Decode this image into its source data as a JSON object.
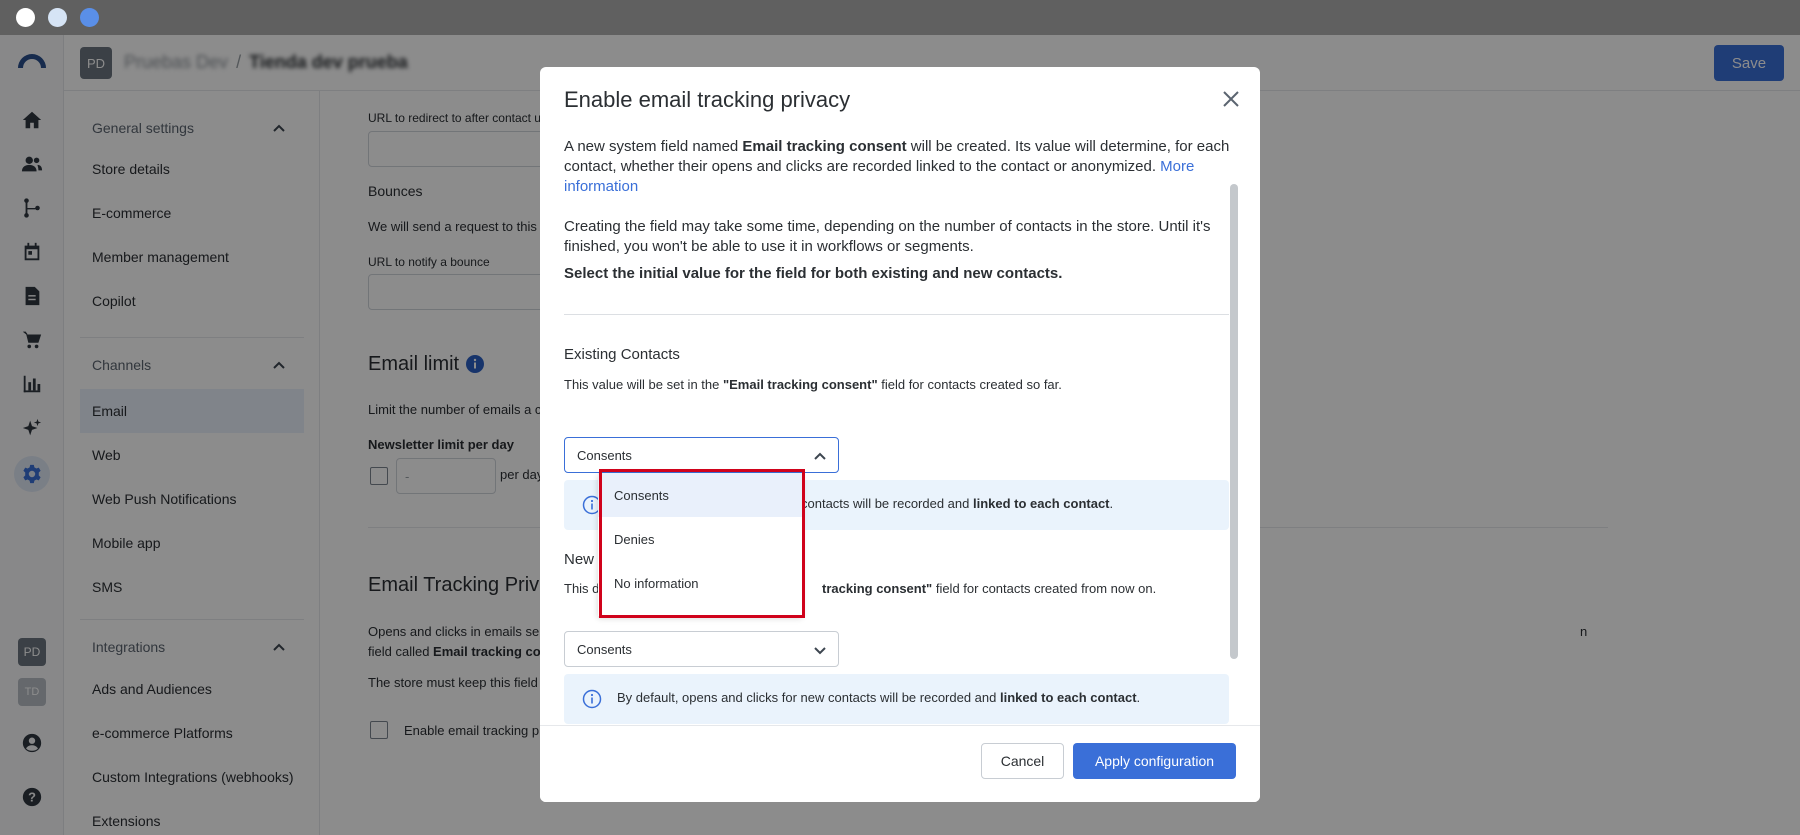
{
  "colors": {
    "accent": "#3a6fd8",
    "highlight_border": "#d0021b",
    "info_bg": "#eaf3fc"
  },
  "header": {
    "avatar_initials": "PD",
    "org_name": "Pruebas Dev",
    "store_name": "Tienda dev prueba",
    "save_label": "Save"
  },
  "rail": {
    "icons": [
      "logo-icon",
      "home-icon",
      "contacts-icon",
      "workflows-icon",
      "calendar-icon",
      "templates-icon",
      "cart-icon",
      "reports-icon",
      "copilot-icon",
      "settings-icon",
      "user-icon",
      "help-icon"
    ],
    "badges": [
      "PD",
      "TD"
    ]
  },
  "sidebar": {
    "general_settings": "General settings",
    "general_items": [
      "Store details",
      "E-commerce",
      "Member management",
      "Copilot"
    ],
    "channels": "Channels",
    "channel_items": [
      "Email",
      "Web",
      "Web Push Notifications",
      "Mobile app",
      "SMS"
    ],
    "integrations": "Integrations",
    "integration_items": [
      "Ads and Audiences",
      "e-commerce Platforms",
      "Custom Integrations (webhooks)",
      "Extensions"
    ]
  },
  "background": {
    "redirect_label": "URL to redirect to after contact uns",
    "bounces_heading": "Bounces",
    "bounces_desc": "We will send a request to this",
    "bounce_url_label": "URL to notify a bounce",
    "email_limit_heading": "Email limit",
    "email_limit_desc": "Limit the number of emails a c",
    "newsletter_limit_label": "Newsletter limit per day",
    "newsletter_placeholder": "-",
    "per_day": "per day",
    "tracking_heading": "Email Tracking Priva",
    "tracking_desc_1": "Opens and clicks in emails ser",
    "tracking_desc_1_end": "n",
    "tracking_desc_2_pre": "field called ",
    "tracking_desc_2_bold": "Email tracking co",
    "tracking_desc_3": "The store must keep this field",
    "enable_checkbox_label": "Enable email tracking p"
  },
  "modal": {
    "title": "Enable email tracking privacy",
    "p1_pre": "A new system field named ",
    "p1_bold": "Email tracking consent",
    "p1_post": " will be created. Its value will determine, for each contact, whether their opens and clicks are recorded linked to the contact or anonymized. ",
    "p1_link": "More information",
    "p2": "Creating the field may take some time, depending on the number of contacts in the store. Until it's finished, you won't be able to use it in workflows or segments.",
    "p3": "Select the initial value for the field for both existing and new contacts.",
    "existing": {
      "heading": "Existing Contacts",
      "desc_pre": "This value will be set in the ",
      "desc_bold": "\"Email tracking consent\"",
      "desc_post": " field for contacts created so far.",
      "value": "Consents",
      "info_pre": "contacts will be recorded and ",
      "info_bold": "linked to each contact",
      "info_post": "."
    },
    "new": {
      "heading": "New",
      "desc_pre": "This d",
      "desc_bold": " tracking consent\"",
      "desc_post": " field for contacts created from now on.",
      "value": "Consents",
      "info_pre": "By default, opens and clicks for new contacts will be recorded and ",
      "info_bold": "linked to each contact",
      "info_post": "."
    },
    "dropdown_options": [
      "Consents",
      "Denies",
      "No information"
    ],
    "cancel_label": "Cancel",
    "apply_label": "Apply configuration"
  }
}
